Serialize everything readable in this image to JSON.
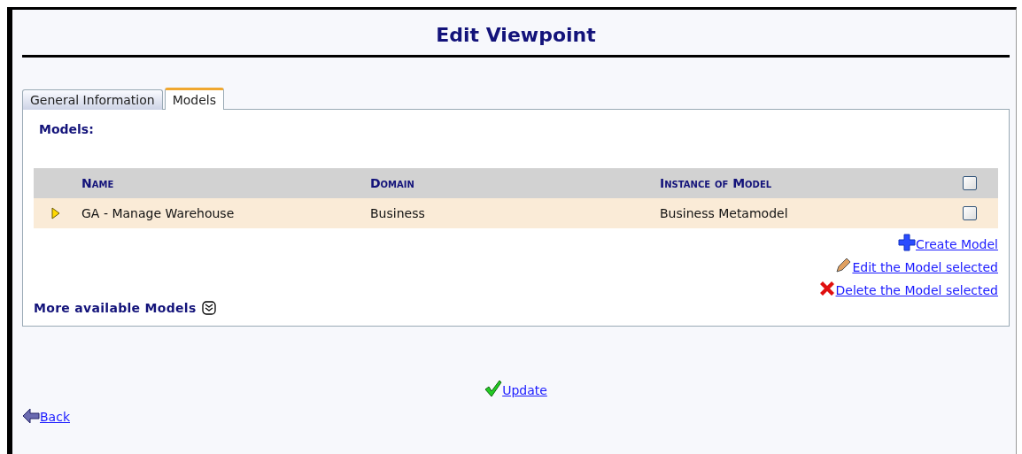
{
  "title": "Edit Viewpoint",
  "tabs": [
    {
      "label": "General Information",
      "selected": false
    },
    {
      "label": "Models",
      "selected": true
    }
  ],
  "section_title": "Models:",
  "table": {
    "columns": [
      "Name",
      "Domain",
      "Instance of Model"
    ],
    "header_checked": false,
    "rows": [
      {
        "cells": [
          "GA - Manage Warehouse",
          "Business",
          "Business Metamodel"
        ],
        "checked": false
      }
    ]
  },
  "actions": [
    {
      "kind": "create",
      "label": "Create Model"
    },
    {
      "kind": "edit",
      "label": "Edit the Model selected"
    },
    {
      "kind": "delete",
      "label": "Delete the Model selected"
    }
  ],
  "more_models": {
    "label": "More available Models",
    "expanded": false
  },
  "update": "Update",
  "back": "Back"
}
